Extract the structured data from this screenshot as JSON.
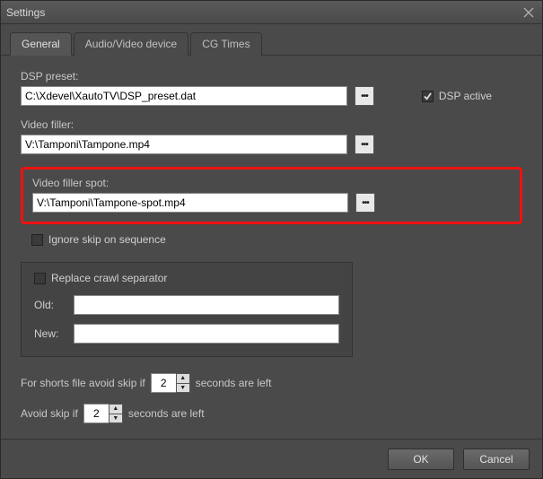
{
  "title": "Settings",
  "tabs": {
    "general": "General",
    "av": "Audio/Video device",
    "cg": "CG Times"
  },
  "dsp": {
    "label": "DSP preset:",
    "value": "C:\\Xdevel\\XautoTV\\DSP_preset.dat",
    "active_label": "DSP active",
    "active_checked": true
  },
  "filler": {
    "label": "Video filler:",
    "value": "V:\\Tamponi\\Tampone.mp4"
  },
  "filler_spot": {
    "label": "Video filler spot:",
    "value": "V:\\Tamponi\\Tampone-spot.mp4"
  },
  "ignore_skip": {
    "label": "Ignore skip on sequence",
    "checked": false
  },
  "replace_crawl": {
    "title": "Replace crawl separator",
    "checked": false,
    "old_label": "Old:",
    "old_value": "",
    "new_label": "New:",
    "new_value": ""
  },
  "shorts": {
    "prefix": "For shorts file avoid skip if",
    "value": "2",
    "suffix": "seconds are left"
  },
  "avoid": {
    "prefix": "Avoid skip if",
    "value": "2",
    "suffix": "seconds are left"
  },
  "buttons": {
    "ok": "OK",
    "cancel": "Cancel"
  },
  "browse_glyph": "•••"
}
